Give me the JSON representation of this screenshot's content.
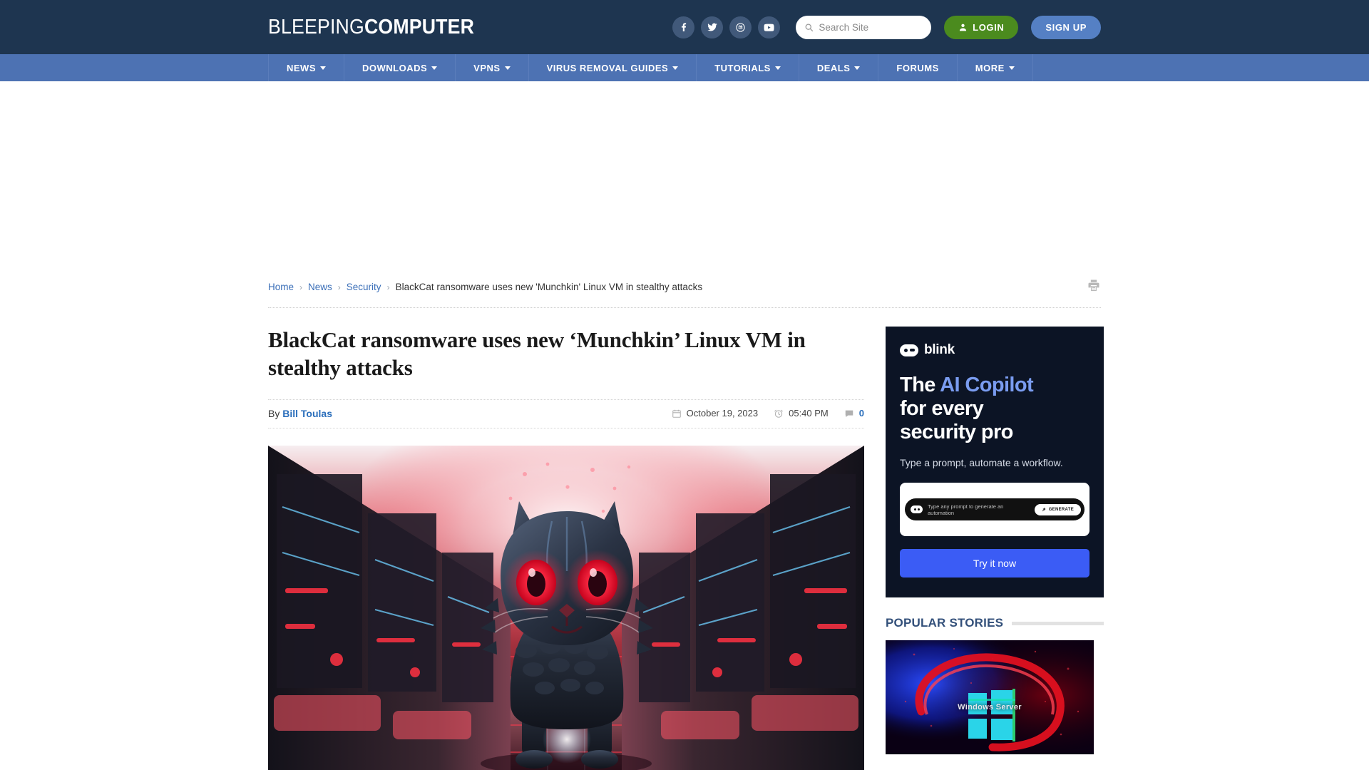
{
  "site": {
    "logo_light": "BLEEPING",
    "logo_bold": "COMPUTER"
  },
  "header": {
    "social": [
      {
        "name": "facebook-icon",
        "label": "Facebook"
      },
      {
        "name": "twitter-icon",
        "label": "Twitter"
      },
      {
        "name": "mastodon-icon",
        "label": "Mastodon"
      },
      {
        "name": "youtube-icon",
        "label": "YouTube"
      }
    ],
    "search": {
      "placeholder": "Search Site",
      "value": ""
    },
    "login_label": "LOGIN",
    "signup_label": "SIGN UP"
  },
  "nav": {
    "items": [
      {
        "label": "NEWS",
        "has_dropdown": true
      },
      {
        "label": "DOWNLOADS",
        "has_dropdown": true
      },
      {
        "label": "VPNS",
        "has_dropdown": true
      },
      {
        "label": "VIRUS REMOVAL GUIDES",
        "has_dropdown": true
      },
      {
        "label": "TUTORIALS",
        "has_dropdown": true
      },
      {
        "label": "DEALS",
        "has_dropdown": true
      },
      {
        "label": "FORUMS",
        "has_dropdown": false
      },
      {
        "label": "MORE",
        "has_dropdown": true
      }
    ]
  },
  "breadcrumb": {
    "items": [
      "Home",
      "News",
      "Security"
    ],
    "current": "BlackCat ransomware uses new 'Munchkin' Linux VM in stealthy attacks",
    "separator": "›"
  },
  "article": {
    "title": "BlackCat ransomware uses new ‘Munchkin’ Linux VM in stealthy attacks",
    "by_label": "By",
    "author": "Bill Toulas",
    "date": "October 19, 2023",
    "time": "05:40 PM",
    "comment_count": "0"
  },
  "sidebar": {
    "ad": {
      "brand": "blink",
      "headline_part1": "The ",
      "headline_highlight": "AI Copilot",
      "headline_part2": "for every",
      "headline_part3": "security pro",
      "subtext": "Type a prompt, automate a workflow.",
      "prompt_placeholder": "Type any prompt to generate an automation",
      "generate_label": "GENERATE",
      "cta_label": "Try it now",
      "accent_color": "#3b5cf5",
      "highlight_color": "#7a9cf0",
      "background_color": "#0c1425"
    },
    "popular": {
      "title": "POPULAR STORIES",
      "first_thumb_label": "Windows Server"
    }
  },
  "colors": {
    "header_bg": "#1e3550",
    "nav_bg": "#4d72b3",
    "login_green": "#4b8b1e",
    "signup_blue": "#5580c4",
    "link_blue": "#3b6fb8"
  }
}
